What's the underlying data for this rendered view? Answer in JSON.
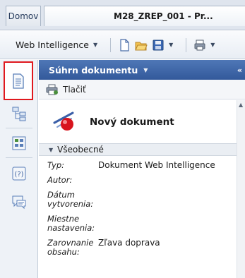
{
  "tabs": {
    "home": "Domov",
    "document": "M28_ZREP_001 - Pr..."
  },
  "toolbar": {
    "app_menu_label": "Web Intelligence"
  },
  "panel": {
    "title": "Súhrn dokumentu",
    "print_label": "Tlačiť",
    "document_name": "Nový dokument",
    "section_title": "Všeobecné",
    "properties": [
      {
        "label": "Typ:",
        "value": "Dokument Web Intelligence"
      },
      {
        "label": "Autor:",
        "value": ""
      },
      {
        "label": "Dátum vytvorenia:",
        "value": ""
      },
      {
        "label": "Miestne nastavenia:",
        "value": ""
      },
      {
        "label": "Zarovnanie obsahu:",
        "value": "Zľava doprava"
      }
    ]
  },
  "colors": {
    "panel_header": "#3e66a8",
    "highlight_border": "#e0181e"
  },
  "icons": {
    "rail": [
      "document-summary-icon",
      "structure-icon",
      "input-controls-icon",
      "help-icon",
      "comments-icon"
    ]
  }
}
